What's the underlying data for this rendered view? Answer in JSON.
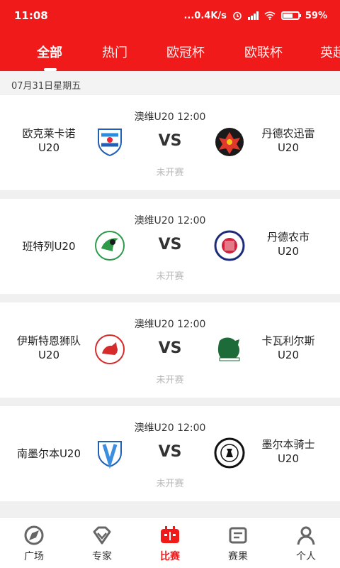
{
  "status_bar": {
    "time": "11:08",
    "network_speed": "...0.4K/s",
    "battery": "59%",
    "battery_level": 0.59
  },
  "tabs": [
    "全部",
    "热门",
    "欧冠杯",
    "欧联杯",
    "英超"
  ],
  "date_header": "07月31日星期五",
  "matches": [
    {
      "time": "澳维U20 12:00",
      "home": [
        "欧克莱卡诺",
        "U20"
      ],
      "away": [
        "丹德农迅雷",
        "U20"
      ],
      "vs": "VS",
      "status": "未开赛"
    },
    {
      "time": "澳维U20 12:00",
      "home": [
        "班特列U20",
        ""
      ],
      "away": [
        "丹德农市",
        "U20"
      ],
      "vs": "VS",
      "status": "未开赛"
    },
    {
      "time": "澳维U20 12:00",
      "home": [
        "伊斯特恩狮队",
        "U20"
      ],
      "away": [
        "卡瓦利尔斯",
        "U20"
      ],
      "vs": "VS",
      "status": "未开赛"
    },
    {
      "time": "澳维U20 12:00",
      "home": [
        "南墨尔本U20",
        ""
      ],
      "away": [
        "墨尔本骑士",
        "U20"
      ],
      "vs": "VS",
      "status": "未开赛"
    }
  ],
  "bottom_nav": [
    {
      "label": "广场",
      "icon": "compass-icon"
    },
    {
      "label": "专家",
      "icon": "diamond-icon"
    },
    {
      "label": "比赛",
      "icon": "scoreboard-icon",
      "active": true
    },
    {
      "label": "赛果",
      "icon": "results-icon"
    },
    {
      "label": "个人",
      "icon": "person-icon"
    }
  ],
  "colors": {
    "brand": "#f11a1a",
    "muted": "#b8b8b8"
  }
}
